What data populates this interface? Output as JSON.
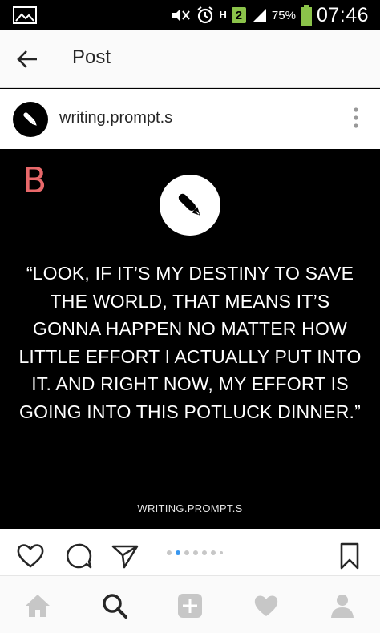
{
  "status_bar": {
    "signal_letter": "H",
    "sim_badge": "2",
    "battery_text": "75%",
    "time": "07:46"
  },
  "header": {
    "title": "Post"
  },
  "post": {
    "username": "writing.prompt.s",
    "corner_letter": "B",
    "quote": "“LOOK, IF IT’S MY DESTINY TO SAVE THE WORLD, THAT MEANS IT’S GONNA HAPPEN NO MATTER HOW LITTLE EFFORT I ACTUALLY PUT INTO IT. AND RIGHT NOW, MY EFFORT IS GOING INTO THIS POTLUCK DINNER.”",
    "watermark": "WRITING.PROMPT.S",
    "carousel": {
      "count": 7,
      "active_index": 1
    }
  },
  "icons": {
    "status": [
      "gallery-icon",
      "mute-icon",
      "alarm-icon",
      "signal-icon",
      "battery-icon"
    ],
    "header": [
      "back-arrow-icon",
      "more-vertical-icon"
    ],
    "actions": [
      "heart-icon",
      "comment-icon",
      "send-icon",
      "bookmark-icon"
    ],
    "nav": [
      "home-icon",
      "search-icon",
      "add-icon",
      "activity-heart-icon",
      "profile-icon"
    ]
  },
  "colors": {
    "accent_letter": "#e8686a",
    "battery": "#8bc34a",
    "carousel_active": "#3897f0"
  }
}
